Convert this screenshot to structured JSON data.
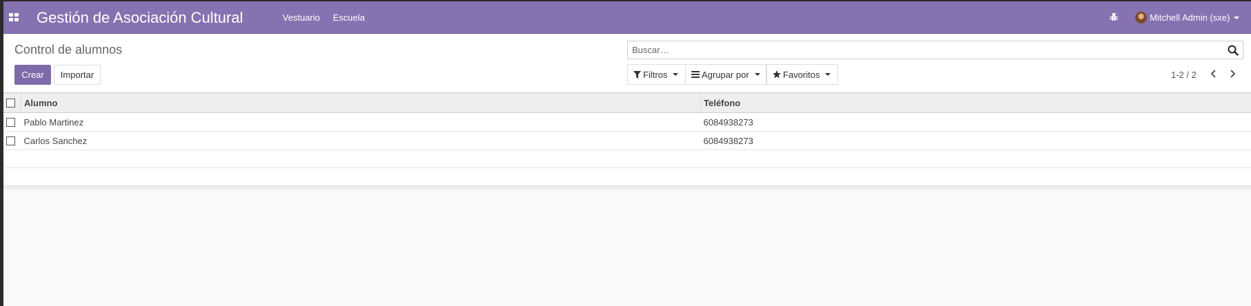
{
  "navbar": {
    "brand": "Gestión de Asociación Cultural",
    "menu": [
      {
        "label": "Vestuario"
      },
      {
        "label": "Escuela"
      }
    ],
    "debug_icon": "bug-icon",
    "user": {
      "name": "Mitchell Admin (sxe)"
    }
  },
  "control_panel": {
    "breadcrumb": "Control de alumnos",
    "create_label": "Crear",
    "import_label": "Importar",
    "search": {
      "placeholder": "Buscar…",
      "value": ""
    },
    "filters_label": "Filtros",
    "groupby_label": "Agrupar por",
    "favorites_label": "Favoritos",
    "pager": {
      "value": "1-2 / 2"
    }
  },
  "list": {
    "columns": [
      "Alumno",
      "Teléfono"
    ],
    "rows": [
      {
        "alumno": "Pablo Martinez",
        "telefono": "6084938273"
      },
      {
        "alumno": "Carlos Sanchez",
        "telefono": "6084938273"
      }
    ]
  },
  "colors": {
    "navbar": "#8672b0",
    "primary": "#7c6aa9"
  }
}
